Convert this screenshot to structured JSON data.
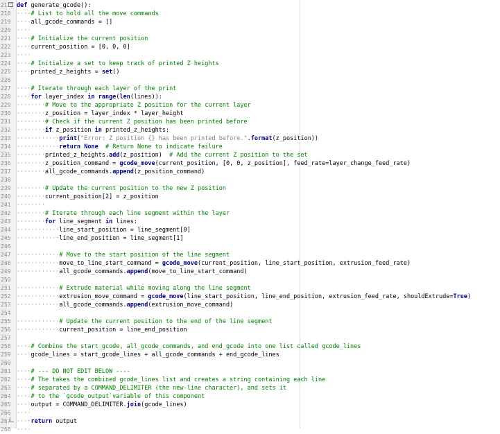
{
  "editor": {
    "lines": [
      {
        "n": "217",
        "text": "def generate_gcode():",
        "fold": "open"
      },
      {
        "n": "218",
        "text": "····# List to hold all the move commands"
      },
      {
        "n": "219",
        "text": "····all_gcode_commands = []"
      },
      {
        "n": "220",
        "text": "····"
      },
      {
        "n": "221",
        "text": "····# Initialize the current position"
      },
      {
        "n": "222",
        "text": "····current_position = [0, 0, 0]"
      },
      {
        "n": "223",
        "text": "····"
      },
      {
        "n": "224",
        "text": "····# Initialize a set to keep track of printed Z heights"
      },
      {
        "n": "225",
        "text": "····printed_z_heights = set()"
      },
      {
        "n": "226",
        "text": ""
      },
      {
        "n": "227",
        "text": "····# Iterate through each layer of the print"
      },
      {
        "n": "228",
        "text": "····for layer_index in range(len(lines)):"
      },
      {
        "n": "229",
        "text": "········# Move to the appropriate Z position for the current layer"
      },
      {
        "n": "230",
        "text": "········z_position = layer_index * layer_height"
      },
      {
        "n": "231",
        "text": "········# Check if the current Z position has been printed before"
      },
      {
        "n": "232",
        "text": "········if z_position in printed_z_heights:"
      },
      {
        "n": "233",
        "text": "············print(\"Error: Z position {} has been printed before.\".format(z_position))"
      },
      {
        "n": "234",
        "text": "············return None  # Return None to indicate failure"
      },
      {
        "n": "235",
        "text": "········printed_z_heights.add(z_position)  # Add the current Z position to the set"
      },
      {
        "n": "236",
        "text": "········z_position_command = gcode_move(current_position, [0, 0, z_position], feed_rate=layer_change_feed_rate)"
      },
      {
        "n": "237",
        "text": "········all_gcode_commands.append(z_position_command)"
      },
      {
        "n": "238",
        "text": ""
      },
      {
        "n": "239",
        "text": "········# Update the current position to the new Z position"
      },
      {
        "n": "240",
        "text": "········current_position[2] = z_position"
      },
      {
        "n": "241",
        "text": "········"
      },
      {
        "n": "242",
        "text": "········# Iterate through each line segment within the layer"
      },
      {
        "n": "243",
        "text": "········for line_segment in lines:"
      },
      {
        "n": "244",
        "text": "············line_start_position = line_segment[0]"
      },
      {
        "n": "245",
        "text": "············line_end_position = line_segment[1]"
      },
      {
        "n": "246",
        "text": ""
      },
      {
        "n": "247",
        "text": "············# Move to the start position of the line segment"
      },
      {
        "n": "248",
        "text": "············move_to_line_start_command = gcode_move(current_position, line_start_position, extrusion_feed_rate)"
      },
      {
        "n": "249",
        "text": "············all_gcode_commands.append(move_to_line_start_command)"
      },
      {
        "n": "250",
        "text": ""
      },
      {
        "n": "251",
        "text": "············# Extrude material while moving along the line segment"
      },
      {
        "n": "252",
        "text": "············extrusion_move_command = gcode_move(line_start_position, line_end_position, extrusion_feed_rate, shouldExtrude=True)"
      },
      {
        "n": "253",
        "text": "············all_gcode_commands.append(extrusion_move_command)"
      },
      {
        "n": "254",
        "text": ""
      },
      {
        "n": "255",
        "text": "············# Update the current position to the end of the line segment"
      },
      {
        "n": "256",
        "text": "············current_position = line_end_position"
      },
      {
        "n": "257",
        "text": ""
      },
      {
        "n": "258",
        "text": "····# Combine the start_gcode, all_gcode_commands, and end_gcode into one list called gcode_lines"
      },
      {
        "n": "259",
        "text": "····gcode_lines = start_gcode_lines + all_gcode_commands + end_gcode_lines"
      },
      {
        "n": "260",
        "text": ""
      },
      {
        "n": "261",
        "text": "····# --- DO NOT EDIT BELOW ----"
      },
      {
        "n": "262",
        "text": "····# The takes the combined gcode_lines list and creates a string containing each line"
      },
      {
        "n": "263",
        "text": "····# separated by a COMMAND_DELIMITER (the new-line character), and sets it"
      },
      {
        "n": "264",
        "text": "····# to the `gcode_output`variable of this component"
      },
      {
        "n": "265",
        "text": "····output = COMMAND_DELIMITER.join(gcode_lines)"
      },
      {
        "n": "266",
        "text": "····"
      },
      {
        "n": "267",
        "text": "····return output",
        "fold": "end"
      },
      {
        "n": "268",
        "text": "····"
      }
    ],
    "colors": {
      "keyword": "#00008b",
      "comment": "#008000",
      "string": "#808080",
      "whitespace_marker": "#9a9a9a",
      "gutter_bg": "#ececec"
    }
  }
}
